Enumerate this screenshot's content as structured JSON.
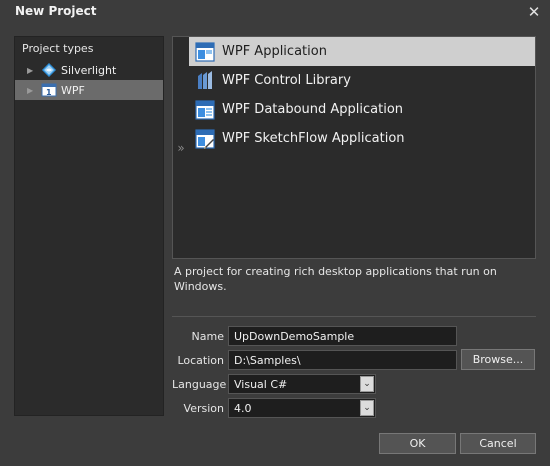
{
  "window": {
    "title": "New Project",
    "close_glyph": "✕"
  },
  "project_types": {
    "header": "Project types",
    "items": [
      {
        "label": "Silverlight",
        "icon": "silverlight-icon",
        "expanded": false
      },
      {
        "label": "WPF",
        "icon": "wpf-icon",
        "expanded": false,
        "selected": true
      }
    ],
    "arrow_glyph": "▶"
  },
  "templates": {
    "expander_glyph": "»",
    "items": [
      {
        "label": "WPF Application",
        "icon": "wpf-application-icon",
        "selected": true
      },
      {
        "label": "WPF Control Library",
        "icon": "control-library-icon"
      },
      {
        "label": "WPF Databound Application",
        "icon": "databound-application-icon"
      },
      {
        "label": "WPF SketchFlow Application",
        "icon": "sketchflow-application-icon"
      }
    ]
  },
  "description": "A project for creating rich desktop applications that run on Windows.",
  "form": {
    "name_label": "Name",
    "name_value": "UpDownDemoSample",
    "location_label": "Location",
    "location_value": "D:\\Samples\\",
    "browse_label": "Browse...",
    "language_label": "Language",
    "language_value": "Visual C#",
    "version_label": "Version",
    "version_value": "4.0",
    "dropdown_glyph": "⌄"
  },
  "buttons": {
    "ok": "OK",
    "cancel": "Cancel"
  },
  "colors": {
    "background": "#3c3c3c",
    "panel": "#2b2b2b",
    "selection": "#cfcfcf",
    "tree_selection": "#6b6b6b"
  }
}
